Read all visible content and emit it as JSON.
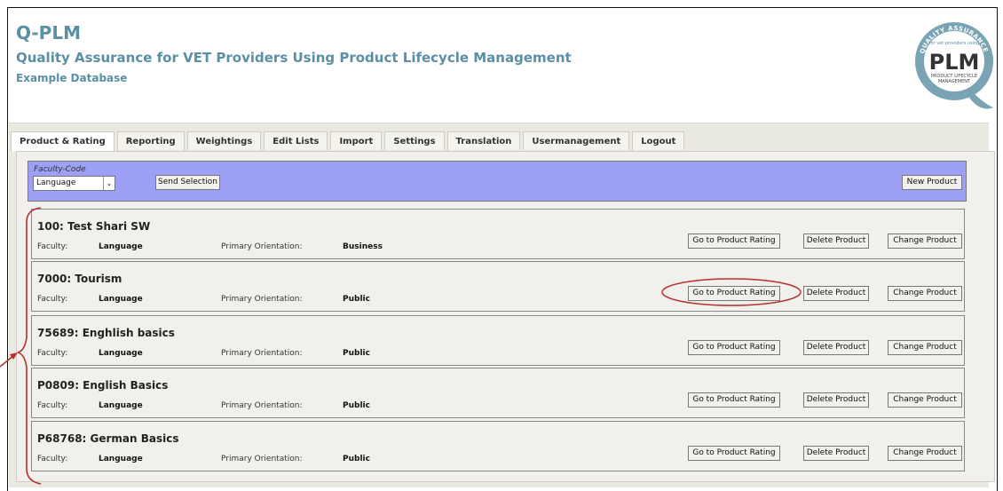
{
  "header": {
    "title": "Q-PLM",
    "subtitle": "Quality Assurance for VET Providers Using Product Lifecycle Management",
    "database": "Example Database",
    "logo": {
      "ring_text": "QUALITY ASSURANCE",
      "small_text": "for vet providers using",
      "big_text": "PLM",
      "bottom_text1": "PRODUCT LIFECYCLE",
      "bottom_text2": "MANAGEMENT",
      "letter": "Q"
    }
  },
  "tabs": [
    {
      "label": "Product & Rating",
      "active": true
    },
    {
      "label": "Reporting",
      "active": false
    },
    {
      "label": "Weightings",
      "active": false
    },
    {
      "label": "Edit Lists",
      "active": false
    },
    {
      "label": "Import",
      "active": false
    },
    {
      "label": "Settings",
      "active": false
    },
    {
      "label": "Translation",
      "active": false
    },
    {
      "label": "Usermanagement",
      "active": false
    },
    {
      "label": "Logout",
      "active": false
    }
  ],
  "filter": {
    "label": "Faculty-Code",
    "selected": "Language",
    "send_label": "Send Selection",
    "new_label": "New Product"
  },
  "labels": {
    "faculty": "Faculty:",
    "orientation": "Primary Orientation:",
    "go_rating": "Go to Product Rating",
    "delete": "Delete Product",
    "change": "Change Product"
  },
  "products": [
    {
      "title": "100: Test Shari SW",
      "faculty": "Language",
      "orientation": "Business"
    },
    {
      "title": "7000: Tourism",
      "faculty": "Language",
      "orientation": "Public"
    },
    {
      "title": "75689: Enghlish basics",
      "faculty": "Language",
      "orientation": "Public"
    },
    {
      "title": "P0809: English Basics",
      "faculty": "Language",
      "orientation": "Public"
    },
    {
      "title": "P68768: German Basics",
      "faculty": "Language",
      "orientation": "Public"
    }
  ],
  "colors": {
    "brand": "#5b8fa3",
    "filter_bar": "#9ea0f6",
    "annotation": "#b5322f"
  }
}
